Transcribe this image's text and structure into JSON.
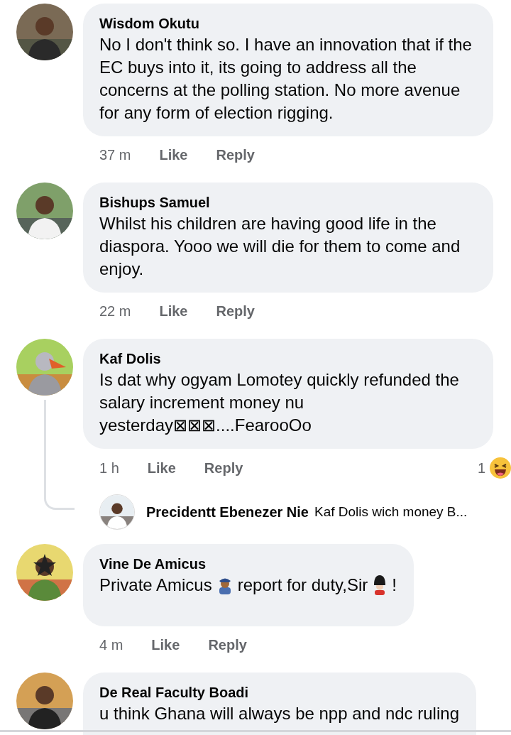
{
  "comments": [
    {
      "name": "Wisdom Okutu",
      "text": "No I don't think so. I have an innovation that if the EC buys into it, its going to address all the concerns at the polling station. No more avenue for any form of election rigging.",
      "time": "37 m",
      "like": "Like",
      "reply": "Reply"
    },
    {
      "name": "Bishups Samuel",
      "text": "Whilst his children are having good life in the diaspora. Yooo we will die for them to come and enjoy.",
      "time": "22 m",
      "like": "Like",
      "reply": "Reply"
    },
    {
      "name": "Kaf Dolis",
      "text": "Is dat why ogyam Lomotey quickly refunded the salary increment money nu yesterday⊠⊠⊠....FearooOo",
      "time": "1 h",
      "like": "Like",
      "reply": "Reply",
      "reaction": {
        "count": "1"
      },
      "replies": [
        {
          "name": "Precidentt Ebenezer Nie",
          "text": "Kaf Dolis wich money B..."
        }
      ]
    },
    {
      "name": "Vine De Amicus",
      "text_parts": [
        {
          "kind": "text",
          "text": "Private Amicus"
        },
        {
          "kind": "officer"
        },
        {
          "kind": "text",
          "text": "report for duty,Sir"
        },
        {
          "kind": "guard"
        },
        {
          "kind": "text",
          "text": "!"
        }
      ],
      "time": "4 m",
      "like": "Like",
      "reply": "Reply"
    },
    {
      "name": "De Real Faculty Boadi",
      "text": "u think Ghana will always be npp and ndc ruling"
    }
  ]
}
